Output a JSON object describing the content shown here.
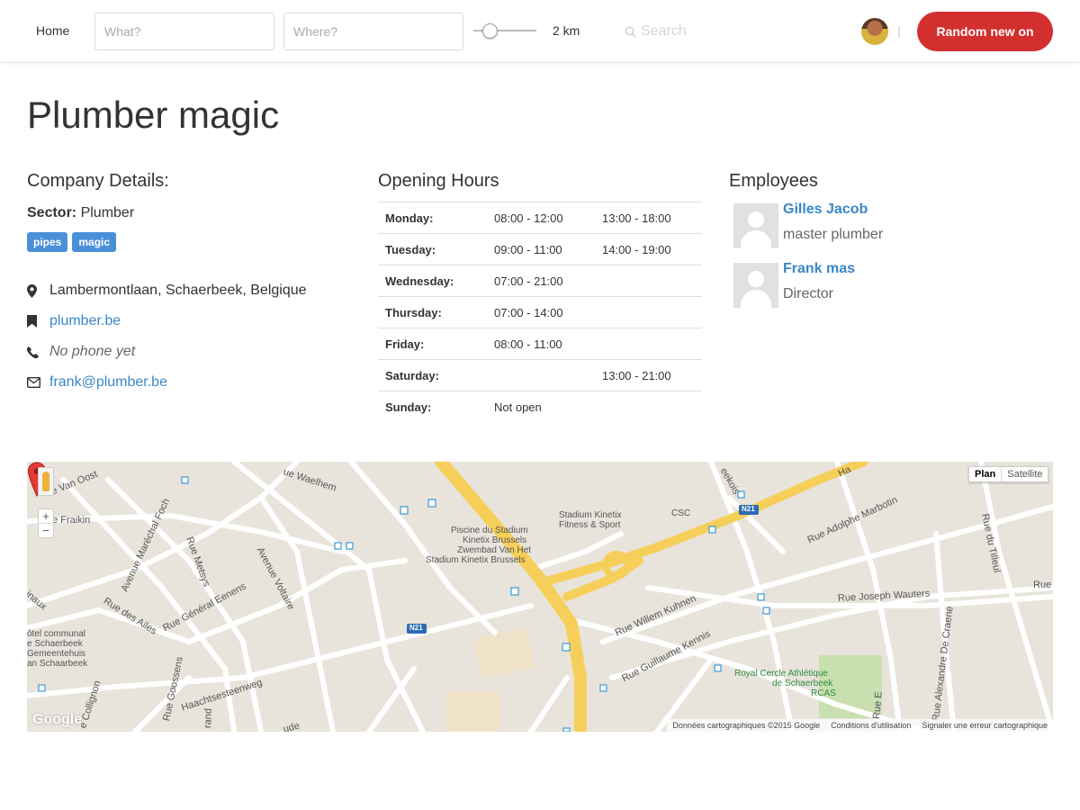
{
  "nav": {
    "home_label": "Home",
    "what_placeholder": "What?",
    "where_placeholder": "Where?",
    "distance_label": "2 km",
    "distance_km": 2,
    "search_label": "Search",
    "separator": "|",
    "random_button_label": "Random new on",
    "random_button_color": "#d32f2f"
  },
  "page": {
    "title": "Plumber magic"
  },
  "company": {
    "section_title": "Company Details:",
    "sector_label": "Sector:",
    "sector_value": "Plumber",
    "tags": [
      "pipes",
      "magic"
    ],
    "address": "Lambermontlaan, Schaerbeek, Belgique",
    "website": "plumber.be",
    "phone": "No phone yet",
    "email": "frank@plumber.be",
    "icons": [
      "map-marker-icon",
      "bookmark-icon",
      "phone-icon",
      "envelope-icon"
    ]
  },
  "hours": {
    "section_title": "Opening Hours",
    "rows": [
      {
        "day": "Monday:",
        "slot1": "08:00 - 12:00",
        "slot2": "13:00 - 18:00"
      },
      {
        "day": "Tuesday:",
        "slot1": "09:00 - 11:00",
        "slot2": "14:00 - 19:00"
      },
      {
        "day": "Wednesday:",
        "slot1": "07:00 - 21:00",
        "slot2": ""
      },
      {
        "day": "Thursday:",
        "slot1": "07:00 - 14:00",
        "slot2": ""
      },
      {
        "day": "Friday:",
        "slot1": "08:00 - 11:00",
        "slot2": ""
      },
      {
        "day": "Saturday:",
        "slot1": "",
        "slot2": "13:00 - 21:00"
      },
      {
        "day": "Sunday:",
        "slot1": "Not open",
        "slot2": ""
      }
    ]
  },
  "employees": {
    "section_title": "Employees",
    "list": [
      {
        "name": "Gilles Jacob",
        "role": "master plumber"
      },
      {
        "name": "Frank mas",
        "role": "Director"
      }
    ]
  },
  "map": {
    "map_type_plan": "Plan",
    "map_type_satellite": "Satellite",
    "zoom_in": "+",
    "zoom_out": "−",
    "google_logo": "Google",
    "footer": {
      "data_credit": "Données cartographiques ©2015 Google",
      "terms": "Conditions d'utilisation",
      "report": "Signaler une erreur cartographique"
    },
    "labels": {
      "stadium": "Stadium Kinetix",
      "stadium_sub": "Fitness & Sport",
      "piscine1": "Piscine du Stadium",
      "piscine2": "Kinetix Brussels",
      "piscine3": "Zwembad Van Het",
      "piscine4": "Stadium Kinetix Brussels",
      "csc": "CSC",
      "n21a": "N21",
      "n21b": "N21",
      "royal1": "Royal Cercle Athlétique",
      "royal2": "de Schaerbeek",
      "royal3": "RCAS",
      "hotel1": "ôtel communal",
      "hotel2": "e Schaerbeek",
      "hotel3": "Gemeentehuis",
      "hotel4": "an Schaarbeek"
    },
    "streets": {
      "van_oost": "ue Van Oost",
      "waelhem": "ue Waelhem",
      "fraikin": "ue Fraikin",
      "marechal_foch": "Avenue Maréchal Foch",
      "metsys": "Rue Metsys",
      "voltaire": "Avenue Voltaire",
      "des_ailes": "Rue des Ailes",
      "general_eenens": "Rue Général Eenens",
      "inaux": "inaux",
      "goossens": "Rue Goossens",
      "haecht": "Haachtsesteenweg",
      "collignon": "e Collignon",
      "rand": "rand",
      "ude": "ude",
      "eekois": "eekois",
      "adolphe_marbotin": "Rue Adolphe Marbotin",
      "tilleul": "Rue du Tilleul",
      "rue": "Rue",
      "willem_kuhnen": "Rue Willem Kuhnen",
      "joseph_wauters": "Rue Joseph Wauters",
      "guillaume_kennis": "Rue Guillaume Kennis",
      "alexandre_de_craene": "Rue Alexandre De Craene",
      "eene": "Rue E",
      "ha": "Ha"
    }
  }
}
